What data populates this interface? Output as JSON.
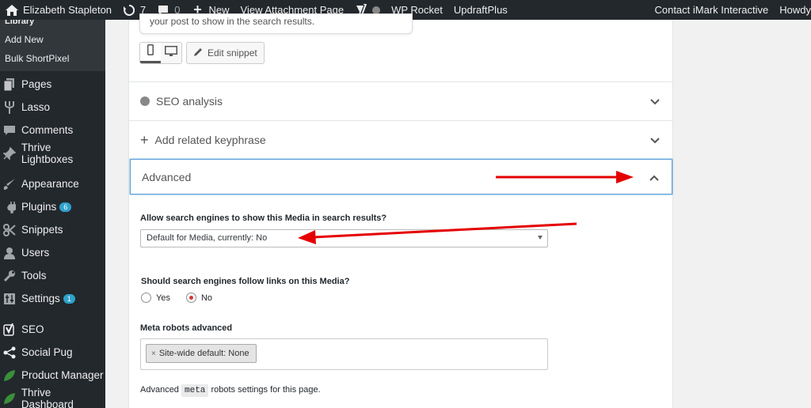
{
  "admin_bar": {
    "user": "Elizabeth Stapleton",
    "updates_count": "7",
    "comments_count": "0",
    "new_label": "New",
    "view_label": "View Attachment Page",
    "wp_rocket": "WP Rocket",
    "updraft": "UpdraftPlus",
    "contact": "Contact iMark Interactive",
    "howdy": "Howdy"
  },
  "sidebar": {
    "submenu": [
      {
        "label": "Library"
      },
      {
        "label": "Add New"
      },
      {
        "label": "Bulk ShortPixel"
      }
    ],
    "items": [
      {
        "label": "Pages",
        "icon": "pages-icon"
      },
      {
        "label": "Lasso",
        "icon": "lasso-icon"
      },
      {
        "label": "Comments",
        "icon": "comments-icon"
      },
      {
        "label": "Thrive Lightboxes",
        "icon": "pin-icon"
      },
      {
        "label": "Appearance",
        "icon": "appearance-icon"
      },
      {
        "label": "Plugins",
        "icon": "plugins-icon",
        "badge": "6"
      },
      {
        "label": "Snippets",
        "icon": "snippets-icon"
      },
      {
        "label": "Users",
        "icon": "users-icon"
      },
      {
        "label": "Tools",
        "icon": "tools-icon"
      },
      {
        "label": "Settings",
        "icon": "settings-icon",
        "badge": "1"
      },
      {
        "label": "SEO",
        "icon": "yoast-icon"
      },
      {
        "label": "Social Pug",
        "icon": "share-icon"
      },
      {
        "label": "Product Manager",
        "icon": "leaf-icon"
      },
      {
        "label": "Thrive Dashboard",
        "icon": "leaf-icon"
      }
    ]
  },
  "panel": {
    "snippet_text": "your post to show in the search results.",
    "edit_snippet": "Edit snippet",
    "sections": {
      "seo_analysis": "SEO analysis",
      "related_keyphrase": "Add related keyphrase",
      "advanced": "Advanced"
    },
    "allow_label": "Allow search engines to show this Media in search results?",
    "allow_value": "Default for Media, currently: No",
    "follow_label": "Should search engines follow links on this Media?",
    "follow_yes": "Yes",
    "follow_no": "No",
    "meta_label": "Meta robots advanced",
    "meta_chip": "Site-wide default: None",
    "help_prefix": "Advanced",
    "help_code": "meta",
    "help_suffix": "robots settings for this page."
  },
  "colors": {
    "admin_bg": "#23282d",
    "accent_blue": "#5b9dd9",
    "badge": "#2ea2cc",
    "arrow_red": "#e50000"
  }
}
